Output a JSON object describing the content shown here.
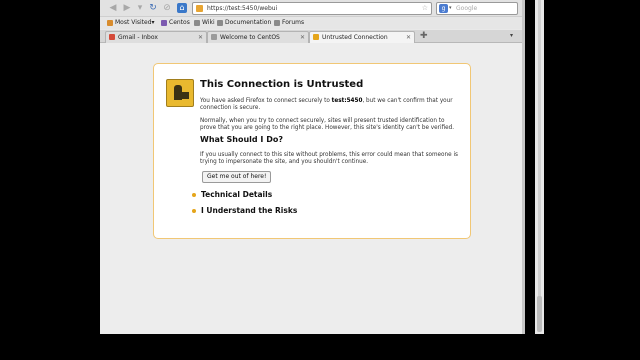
{
  "navbar": {
    "url": "https://test:5450/webui",
    "search_placeholder": "Google"
  },
  "bookmarks": [
    {
      "label": "Most Visited",
      "arrow": "▾"
    },
    {
      "label": "Centos"
    },
    {
      "label": "Wiki"
    },
    {
      "label": "Documentation"
    },
    {
      "label": "Forums"
    }
  ],
  "tabs": [
    {
      "label": "Gmail - Inbox",
      "active": false
    },
    {
      "label": "Welcome to CentOS",
      "active": false
    },
    {
      "label": "Untrusted Connection",
      "active": true
    }
  ],
  "error_page": {
    "title": "This Connection is Untrusted",
    "p1_pre": "You have asked Firefox to connect securely to ",
    "p1_host": "test:5450",
    "p1_post": ", but we can't confirm that your connection is secure.",
    "p2": "Normally, when you try to connect securely, sites will present trusted identification to prove that you are going to the right place. However, this site's identity can't be verified.",
    "heading2": "What Should I Do?",
    "p3": "If you usually connect to this site without problems, this error could mean that someone is trying to impersonate the site, and you shouldn't continue.",
    "button": "Get me out of here!",
    "technical_details": "Technical Details",
    "understand_risks": "I Understand the Risks"
  },
  "colors": {
    "box_border": "#f1c775",
    "warning_icon": "#e9b92f",
    "bullet": "#e5a51a"
  }
}
